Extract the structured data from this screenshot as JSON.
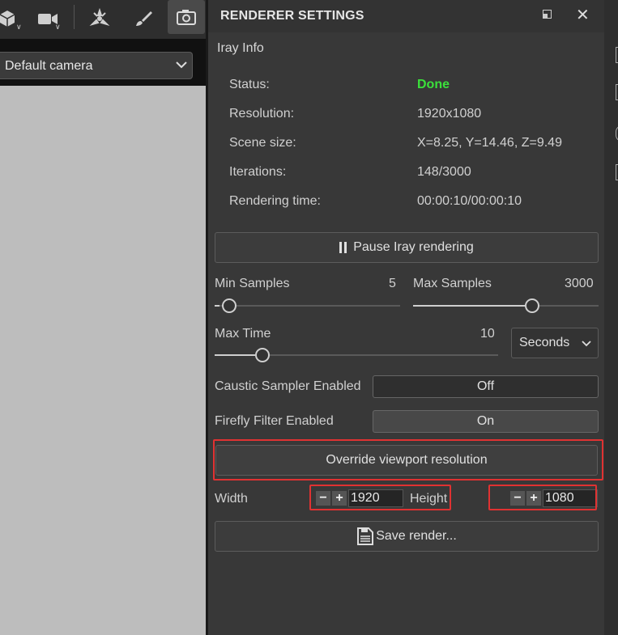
{
  "viewport": {
    "camera": "Default camera"
  },
  "panel": {
    "title": "RENDERER SETTINGS",
    "info_section": "Iray Info",
    "info": [
      {
        "key": "Status:",
        "value": "Done"
      },
      {
        "key": "Resolution:",
        "value": "1920x1080"
      },
      {
        "key": "Scene size:",
        "value": "X=8.25, Y=14.46, Z=9.49"
      },
      {
        "key": "Iterations:",
        "value": "148/3000"
      },
      {
        "key": "Rendering time:",
        "value": "00:00:10/00:00:10"
      }
    ],
    "pause_button": "Pause Iray rendering",
    "min_samples": {
      "label": "Min Samples",
      "value": "5"
    },
    "max_samples": {
      "label": "Max Samples",
      "value": "3000"
    },
    "max_time": {
      "label": "Max Time",
      "value": "10",
      "unit": "Seconds"
    },
    "caustic": {
      "label": "Caustic Sampler Enabled",
      "value": "Off"
    },
    "firefly": {
      "label": "Firefly Filter Enabled",
      "value": "On"
    },
    "override_button": "Override viewport resolution",
    "width": {
      "label": "Width",
      "value": "1920"
    },
    "height": {
      "label": "Height",
      "value": "1080"
    },
    "save_button": "Save render..."
  },
  "colors": {
    "status_done": "#3be03b",
    "highlight": "#e03232"
  }
}
